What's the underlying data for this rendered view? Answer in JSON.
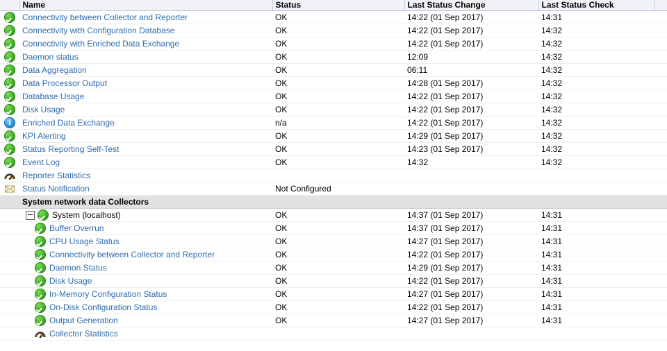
{
  "table": {
    "columns": [
      {
        "key": "icon",
        "label": ""
      },
      {
        "key": "name",
        "label": "Name"
      },
      {
        "key": "status",
        "label": "Status"
      },
      {
        "key": "change",
        "label": "Last Status Change"
      },
      {
        "key": "check",
        "label": "Last Status Check"
      }
    ],
    "colors": {
      "link": "#2f6cab",
      "header_bg": "#f0f2f5",
      "group_bg": "#e2e2e2",
      "ok_green": "#3faa27",
      "info_blue": "#2a90d8",
      "gauge_orange": "#f39c12",
      "mail_tan": "#cdbb85"
    },
    "rows": [
      {
        "icon": "ok-icon",
        "name": "Connectivity between Collector and Reporter",
        "link": true,
        "status": "OK",
        "change": "14:22 (01 Sep 2017)",
        "check": "14:31",
        "indent": 0,
        "group": false,
        "toggle": false
      },
      {
        "icon": "ok-icon",
        "name": "Connectivity with Configuration Database",
        "link": true,
        "status": "OK",
        "change": "14:22 (01 Sep 2017)",
        "check": "14:32",
        "indent": 0,
        "group": false,
        "toggle": false
      },
      {
        "icon": "ok-icon",
        "name": "Connectivity with Enriched Data Exchange",
        "link": true,
        "status": "OK",
        "change": "14:22 (01 Sep 2017)",
        "check": "14:32",
        "indent": 0,
        "group": false,
        "toggle": false
      },
      {
        "icon": "ok-icon",
        "name": "Daemon status",
        "link": true,
        "status": "OK",
        "change": "12:09",
        "check": "14:32",
        "indent": 0,
        "group": false,
        "toggle": false
      },
      {
        "icon": "ok-icon",
        "name": "Data Aggregation",
        "link": true,
        "status": "OK",
        "change": "06:11",
        "check": "14:32",
        "indent": 0,
        "group": false,
        "toggle": false
      },
      {
        "icon": "ok-icon",
        "name": "Data Processor Output",
        "link": true,
        "status": "OK",
        "change": "14:28 (01 Sep 2017)",
        "check": "14:32",
        "indent": 0,
        "group": false,
        "toggle": false
      },
      {
        "icon": "ok-icon",
        "name": "Database Usage",
        "link": true,
        "status": "OK",
        "change": "14:22 (01 Sep 2017)",
        "check": "14:32",
        "indent": 0,
        "group": false,
        "toggle": false
      },
      {
        "icon": "ok-icon",
        "name": "Disk Usage",
        "link": true,
        "status": "OK",
        "change": "14:22 (01 Sep 2017)",
        "check": "14:32",
        "indent": 0,
        "group": false,
        "toggle": false
      },
      {
        "icon": "info-icon",
        "name": "Enriched Data Exchange",
        "link": true,
        "status": "n/a",
        "change": "14:22 (01 Sep 2017)",
        "check": "14:32",
        "indent": 0,
        "group": false,
        "toggle": false
      },
      {
        "icon": "ok-icon",
        "name": "KPI Alerting",
        "link": true,
        "status": "OK",
        "change": "14:29 (01 Sep 2017)",
        "check": "14:32",
        "indent": 0,
        "group": false,
        "toggle": false
      },
      {
        "icon": "ok-icon",
        "name": "Status Reporting Self-Test",
        "link": true,
        "status": "OK",
        "change": "14:23 (01 Sep 2017)",
        "check": "14:32",
        "indent": 0,
        "group": false,
        "toggle": false
      },
      {
        "icon": "ok-icon",
        "name": "Event Log",
        "link": true,
        "status": "OK",
        "change": "14:32",
        "check": "14:32",
        "indent": 0,
        "group": false,
        "toggle": false
      },
      {
        "icon": "gauge-icon",
        "name": "Reporter Statistics",
        "link": true,
        "status": "",
        "change": "",
        "check": "",
        "indent": 0,
        "group": false,
        "toggle": false
      },
      {
        "icon": "mail-icon",
        "name": "Status Notification",
        "link": true,
        "status": "Not Configured",
        "change": "",
        "check": "",
        "indent": 0,
        "group": false,
        "toggle": false
      },
      {
        "icon": "",
        "name": "System network data Collectors",
        "link": false,
        "status": "",
        "change": "",
        "check": "",
        "indent": 0,
        "group": true,
        "toggle": false
      },
      {
        "icon": "ok-icon",
        "name": "System (localhost)",
        "link": false,
        "status": "OK",
        "change": "14:37 (01 Sep 2017)",
        "check": "14:31",
        "indent": 0,
        "group": false,
        "toggle": true
      },
      {
        "icon": "ok-icon",
        "name": "Buffer Overrun",
        "link": true,
        "status": "OK",
        "change": "14:37 (01 Sep 2017)",
        "check": "14:31",
        "indent": 1,
        "group": false,
        "toggle": false
      },
      {
        "icon": "ok-icon",
        "name": "CPU Usage Status",
        "link": true,
        "status": "OK",
        "change": "14:27 (01 Sep 2017)",
        "check": "14:31",
        "indent": 1,
        "group": false,
        "toggle": false
      },
      {
        "icon": "ok-icon",
        "name": "Connectivity between Collector and Reporter",
        "link": true,
        "status": "OK",
        "change": "14:22 (01 Sep 2017)",
        "check": "14:31",
        "indent": 1,
        "group": false,
        "toggle": false
      },
      {
        "icon": "ok-icon",
        "name": "Daemon Status",
        "link": true,
        "status": "OK",
        "change": "14:29 (01 Sep 2017)",
        "check": "14:31",
        "indent": 1,
        "group": false,
        "toggle": false
      },
      {
        "icon": "ok-icon",
        "name": "Disk Usage",
        "link": true,
        "status": "OK",
        "change": "14:22 (01 Sep 2017)",
        "check": "14:31",
        "indent": 1,
        "group": false,
        "toggle": false
      },
      {
        "icon": "ok-icon",
        "name": "In-Memory Configuration Status",
        "link": true,
        "status": "OK",
        "change": "14:27 (01 Sep 2017)",
        "check": "14:31",
        "indent": 1,
        "group": false,
        "toggle": false
      },
      {
        "icon": "ok-icon",
        "name": "On-Disk Configuration Status",
        "link": true,
        "status": "OK",
        "change": "14:22 (01 Sep 2017)",
        "check": "14:31",
        "indent": 1,
        "group": false,
        "toggle": false
      },
      {
        "icon": "ok-icon",
        "name": "Output Generation",
        "link": true,
        "status": "OK",
        "change": "14:27 (01 Sep 2017)",
        "check": "14:31",
        "indent": 1,
        "group": false,
        "toggle": false
      },
      {
        "icon": "gauge-icon",
        "name": "Collector Statistics",
        "link": true,
        "status": "",
        "change": "",
        "check": "",
        "indent": 1,
        "group": false,
        "toggle": false
      }
    ]
  }
}
